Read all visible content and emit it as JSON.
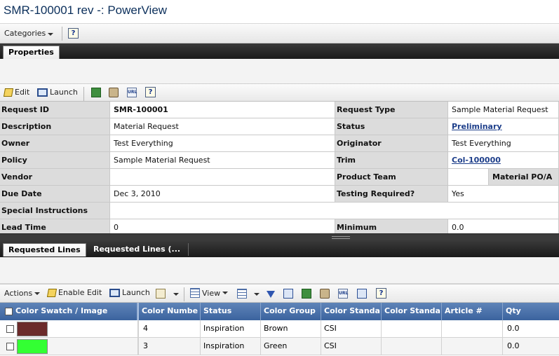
{
  "window": {
    "title": "SMR-100001 rev -: PowerView"
  },
  "categories": {
    "label": "Categories",
    "help": "?"
  },
  "top_tabs": [
    {
      "label": "Properties",
      "active": true
    }
  ],
  "prop_toolbar": {
    "edit": "Edit",
    "launch": "Launch",
    "help": "?"
  },
  "properties": {
    "request_id": {
      "label": "Request ID",
      "value": "SMR-100001"
    },
    "request_type": {
      "label": "Request Type",
      "value": "Sample Material Request"
    },
    "description": {
      "label": "Description",
      "value": "Material Request"
    },
    "status": {
      "label": "Status",
      "value": "Preliminary"
    },
    "owner": {
      "label": "Owner",
      "value": "Test Everything"
    },
    "originator": {
      "label": "Originator",
      "value": "Test Everything"
    },
    "policy": {
      "label": "Policy",
      "value": "Sample Material Request"
    },
    "trim": {
      "label": "Trim",
      "value": "Col-100000"
    },
    "vendor": {
      "label": "Vendor",
      "value": ""
    },
    "product_team": {
      "label": "Product Team",
      "value": ""
    },
    "material_po": {
      "label": "Material PO/A"
    },
    "due_date": {
      "label": "Due Date",
      "value": "Dec 3, 2010"
    },
    "testing_required": {
      "label": "Testing Required?",
      "value": "Yes"
    },
    "special_instructions": {
      "label": "Special Instructions",
      "value": ""
    },
    "lead_time": {
      "label": "Lead Time",
      "value": "0"
    },
    "minimum": {
      "label": "Minimum",
      "value": "0.0"
    }
  },
  "bottom_tabs": [
    {
      "label": "Requested Lines",
      "active": true
    },
    {
      "label": "Requested Lines (...",
      "active": false
    }
  ],
  "lines_toolbar": {
    "actions": "Actions",
    "enable_edit": "Enable Edit",
    "launch": "Launch",
    "view": "View",
    "help": "?"
  },
  "lines_grid": {
    "columns": [
      "Color Swatch / Image",
      "Color Numbe",
      "Status",
      "Color Group",
      "Color Standa",
      "Color Standa",
      "Article #",
      "Qty"
    ],
    "rows": [
      {
        "swatch_color": "#6b2a2a",
        "color_number": "4",
        "status": "Inspiration",
        "color_group": "Brown",
        "color_standard": "CSI",
        "color_standard2": "",
        "article": "",
        "qty": "0.0"
      },
      {
        "swatch_color": "#33ff33",
        "color_number": "3",
        "status": "Inspiration",
        "color_group": "Green",
        "color_standard": "CSI",
        "color_standard2": "",
        "article": "",
        "qty": "0.0"
      }
    ]
  }
}
